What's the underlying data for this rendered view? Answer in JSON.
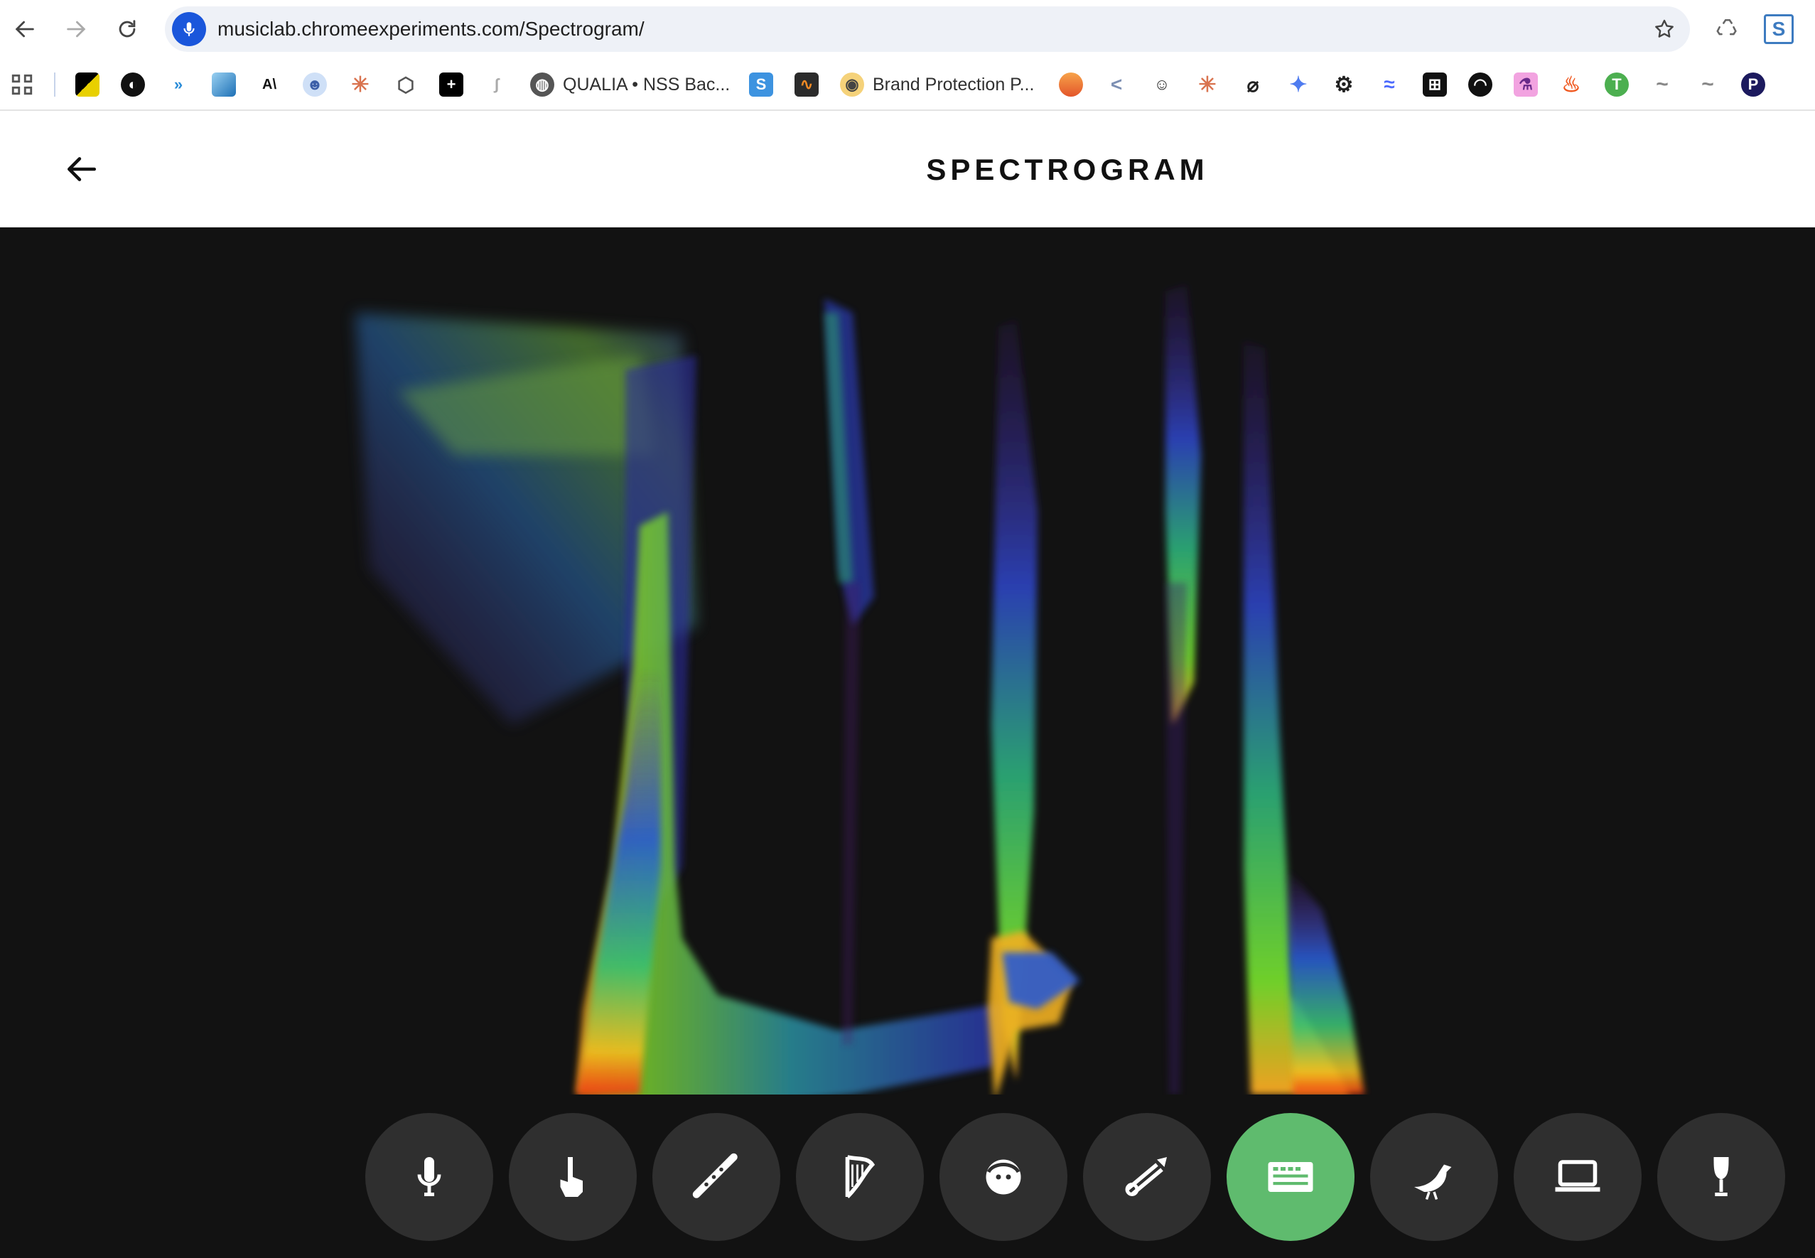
{
  "browser": {
    "url": "musiclab.chromeexperiments.com/Spectrogram/",
    "bookmarks": [
      {
        "icon": "apps-grid-icon",
        "label": ""
      },
      {
        "icon": "checker-icon",
        "label": ""
      },
      {
        "icon": "bird-logo-icon",
        "label": ""
      },
      {
        "icon": "chevron-blue-icon",
        "label": ""
      },
      {
        "icon": "cube-icon",
        "label": ""
      },
      {
        "icon": "anthropic-icon",
        "label": ""
      },
      {
        "icon": "robot-icon",
        "label": ""
      },
      {
        "icon": "claude-burst-icon",
        "label": ""
      },
      {
        "icon": "hexagon-icon",
        "label": ""
      },
      {
        "icon": "plus-box-icon",
        "label": ""
      },
      {
        "icon": "script-s-icon",
        "label": ""
      },
      {
        "icon": "globe-icon",
        "label": "QUALIA • NSS Bac..."
      },
      {
        "icon": "s-square-icon",
        "label": ""
      },
      {
        "icon": "wave-box-icon",
        "label": ""
      },
      {
        "icon": "eye-logo-icon",
        "label": "Brand Protection P..."
      },
      {
        "icon": "sunset-icon",
        "label": ""
      },
      {
        "icon": "share-arrows-icon",
        "label": ""
      },
      {
        "icon": "copilot-icon",
        "label": ""
      },
      {
        "icon": "claude-burst-icon",
        "label": ""
      },
      {
        "icon": "slash-circle-icon",
        "label": ""
      },
      {
        "icon": "gemini-star-icon",
        "label": ""
      },
      {
        "icon": "openai-icon",
        "label": ""
      },
      {
        "icon": "deepseek-whale-icon",
        "label": ""
      },
      {
        "icon": "grid-logo-icon",
        "label": ""
      },
      {
        "icon": "arc-icon",
        "label": ""
      },
      {
        "icon": "flask-icon",
        "label": ""
      },
      {
        "icon": "flame-icon",
        "label": ""
      },
      {
        "icon": "green-circle-icon",
        "label": ""
      },
      {
        "icon": "tilde-icon",
        "label": ""
      },
      {
        "icon": "tilde-icon",
        "label": ""
      },
      {
        "icon": "p-circle-icon",
        "label": ""
      }
    ]
  },
  "app": {
    "title": "SPECTROGRAM",
    "back_icon": "back-arrow-icon",
    "accent_color": "#5fbb6e",
    "button_color": "#2f2f2f",
    "canvas_color": "#121212"
  },
  "instruments": [
    {
      "name": "microphone",
      "icon": "microphone-icon",
      "active": false
    },
    {
      "name": "touch",
      "icon": "pointing-hand-icon",
      "active": false
    },
    {
      "name": "flute",
      "icon": "flute-icon",
      "active": false
    },
    {
      "name": "harp",
      "icon": "harp-icon",
      "active": false
    },
    {
      "name": "voice",
      "icon": "face-icon",
      "active": false
    },
    {
      "name": "trombone",
      "icon": "trombone-icon",
      "active": false
    },
    {
      "name": "synth",
      "icon": "synth-keyboard-icon",
      "active": true
    },
    {
      "name": "bird",
      "icon": "bird-icon",
      "active": false
    },
    {
      "name": "computer",
      "icon": "laptop-icon",
      "active": false
    },
    {
      "name": "wine-glass",
      "icon": "wine-glass-icon",
      "active": false
    }
  ]
}
